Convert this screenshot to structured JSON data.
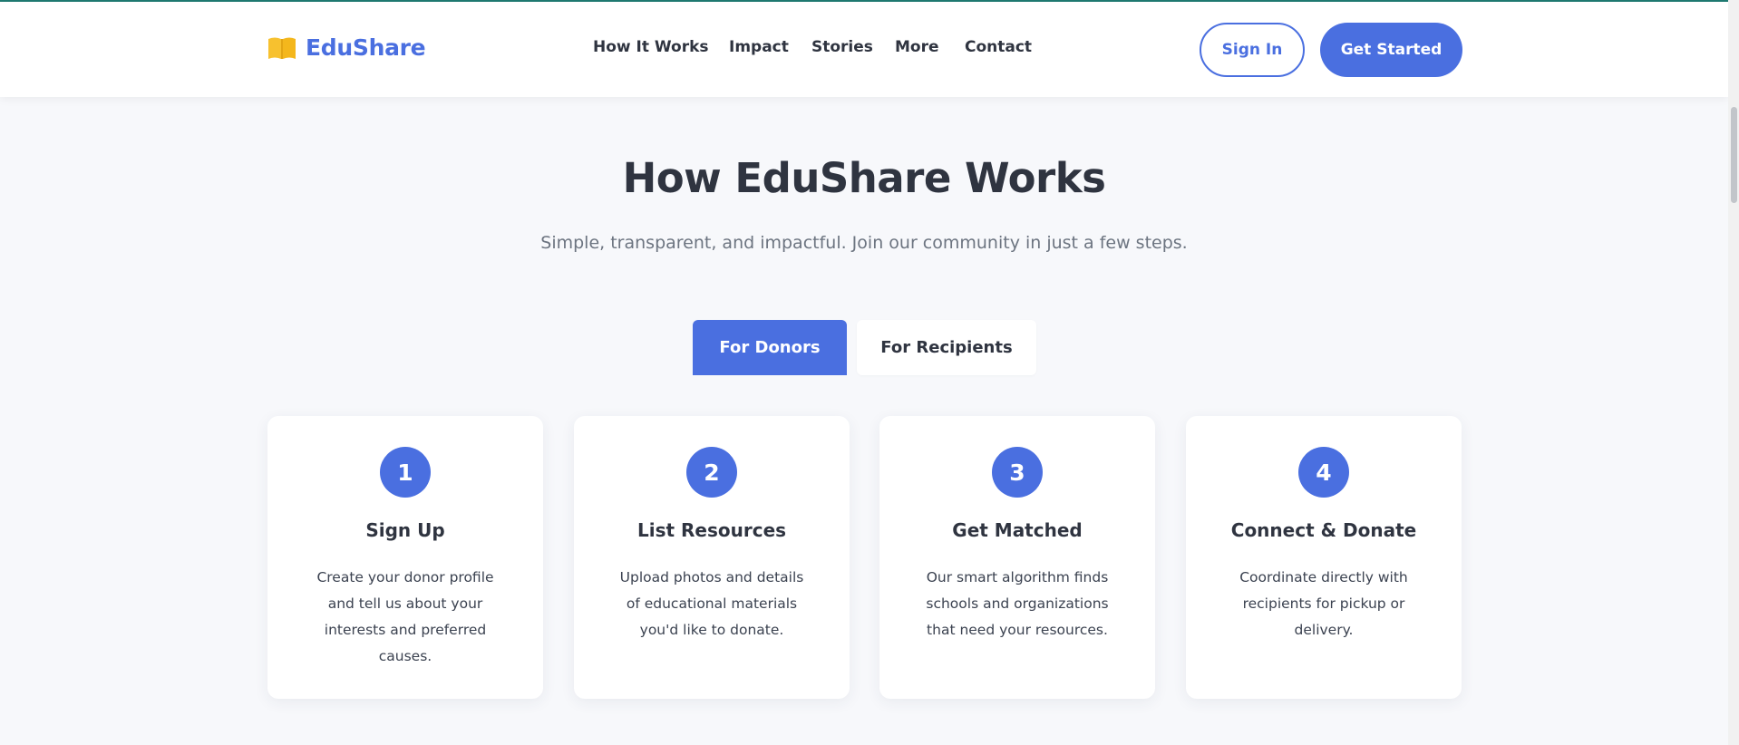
{
  "brand": {
    "name": "EduShare",
    "icon": "open-book-icon",
    "color": "#4a6fe0",
    "icon_color": "#f7c12f"
  },
  "nav": {
    "links": [
      "How It Works",
      "Impact",
      "Stories",
      "More",
      "Contact"
    ],
    "sign_in": "Sign In",
    "get_started": "Get Started"
  },
  "hero": {
    "title": "How EduShare Works",
    "subtitle": "Simple, transparent, and impactful. Join our community in just a few steps."
  },
  "tabs": {
    "donors": "For Donors",
    "recipients": "For Recipients",
    "active": "For Donors"
  },
  "steps": [
    {
      "number": "1",
      "title": "Sign Up",
      "description": "Create your donor profile and tell us about your interests and preferred causes."
    },
    {
      "number": "2",
      "title": "List Resources",
      "description": "Upload photos and details of educational materials you'd like to donate."
    },
    {
      "number": "3",
      "title": "Get Matched",
      "description": "Our smart algorithm finds schools and organizations that need your resources."
    },
    {
      "number": "4",
      "title": "Connect & Donate",
      "description": "Coordinate directly with recipients for pickup or delivery."
    }
  ],
  "colors": {
    "accent": "#4a6fe0",
    "text": "#2f3440",
    "muted": "#6c7480",
    "background": "#f7f8fb"
  }
}
